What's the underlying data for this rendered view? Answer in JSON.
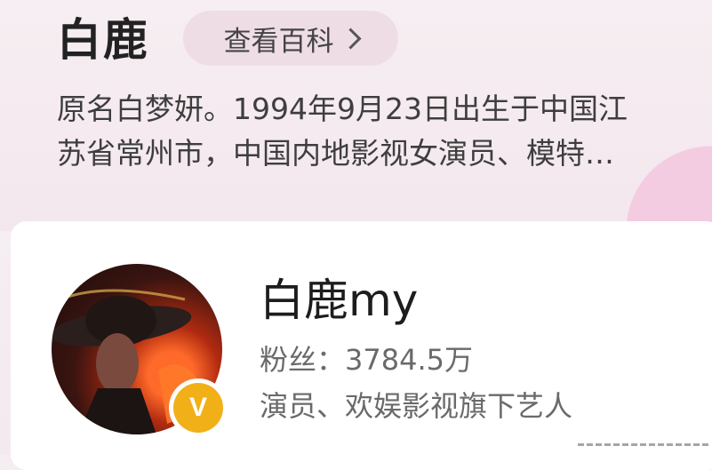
{
  "header": {
    "name": "白鹿",
    "baike_button_label": "查看百科"
  },
  "description": {
    "line1": "原名白梦妍。1994年9月23日出生于中国江",
    "line2": "苏省常州市，中国内地影视女演员、模特…"
  },
  "profile": {
    "username": "白鹿my",
    "fans_label": "粉丝：",
    "fans_count": "3784.5万",
    "role": "演员、欢娱影视旗下艺人",
    "badge_text": "V",
    "badge_color": "#f2b018"
  },
  "colors": {
    "background": "#f4edf1",
    "button_bg": "#efdde6",
    "card_bg": "#ffffff"
  }
}
